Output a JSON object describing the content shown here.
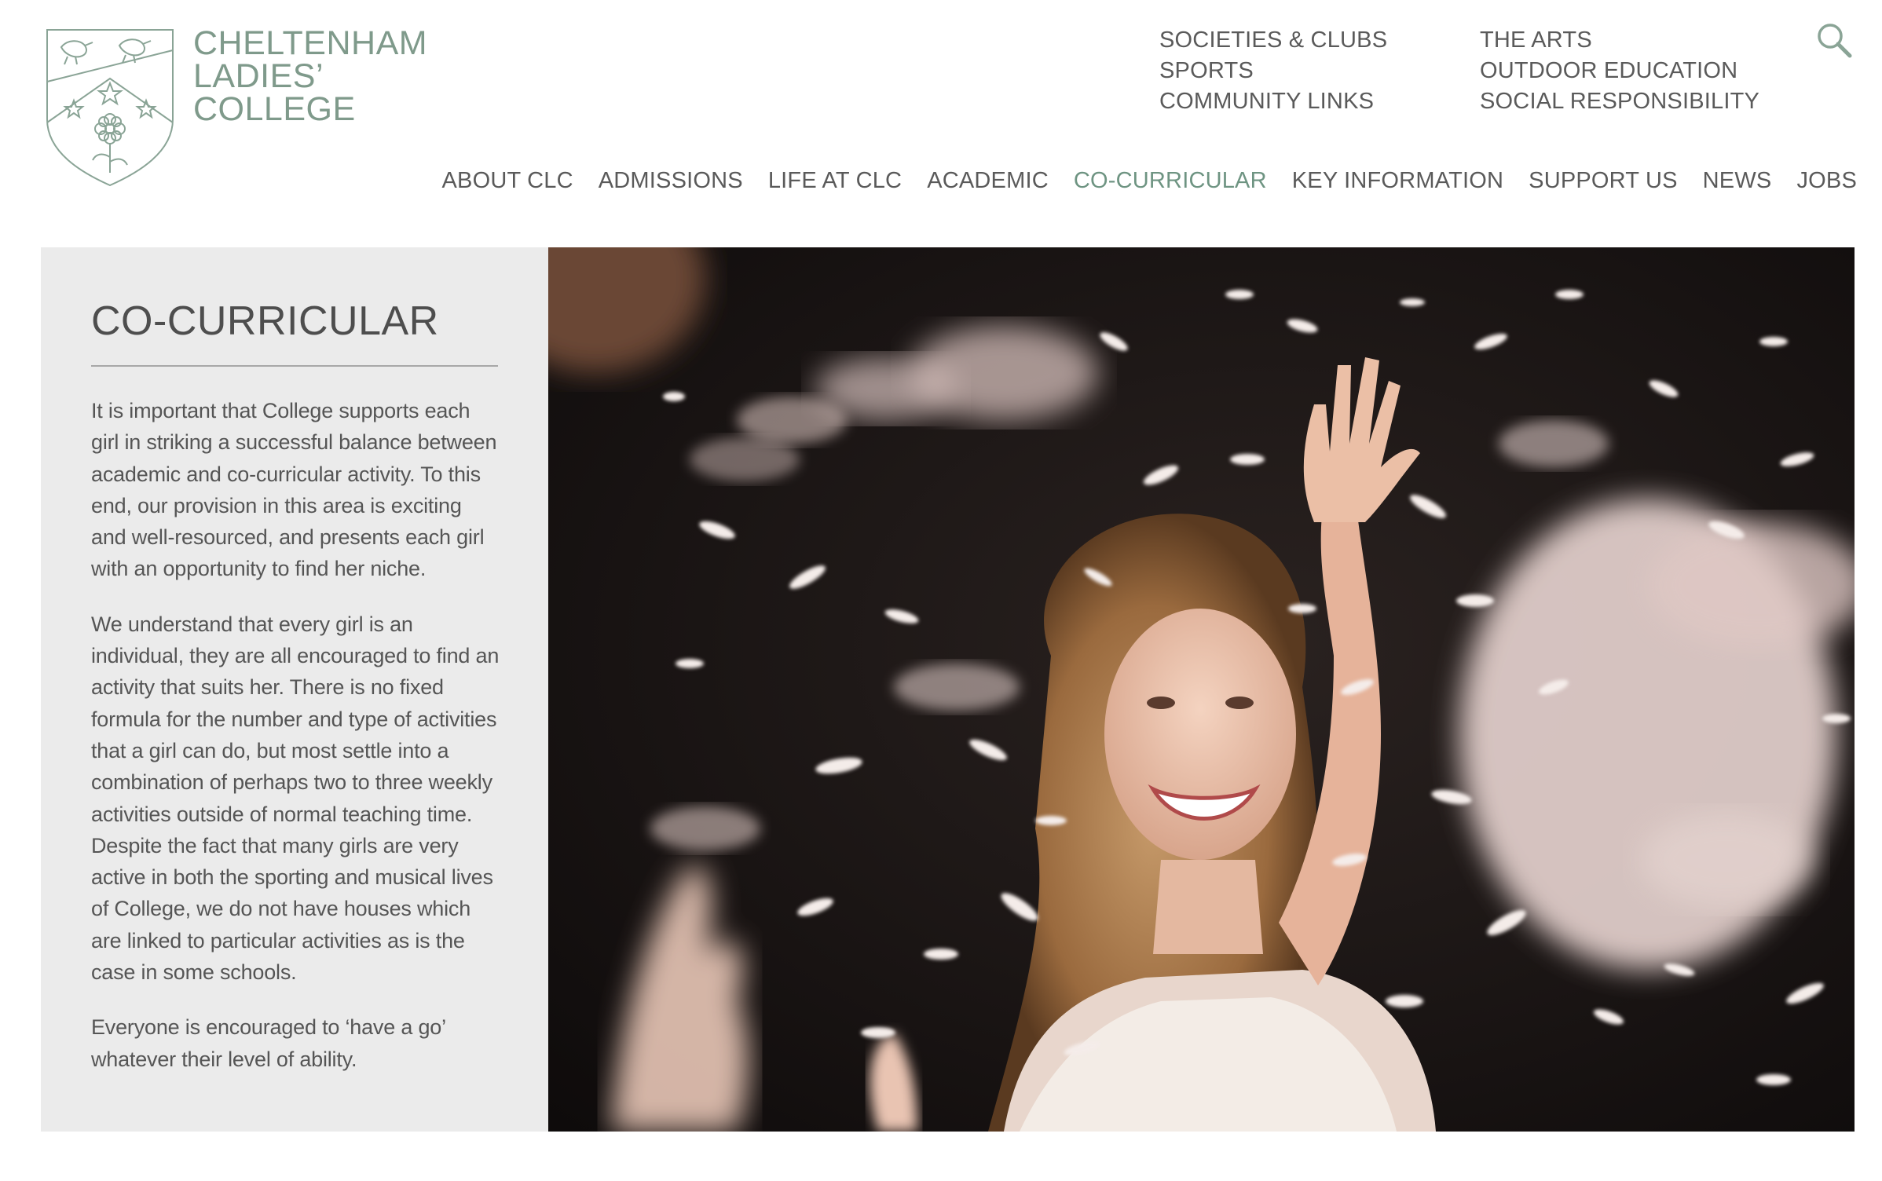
{
  "logo": {
    "line1": "CHELTENHAM",
    "line2": "LADIES’",
    "line3": "COLLEGE",
    "crest_icon": "school-crest-icon",
    "brand_color": "#7f9a8b"
  },
  "subnav": {
    "col1": [
      "SOCIETIES & CLUBS",
      "SPORTS",
      "COMMUNITY LINKS"
    ],
    "col2": [
      "THE ARTS",
      "OUTDOOR EDUCATION",
      "SOCIAL RESPONSIBILITY"
    ],
    "search_icon": "search-icon"
  },
  "mainnav": {
    "items": [
      "ABOUT CLC",
      "ADMISSIONS",
      "LIFE AT CLC",
      "ACADEMIC",
      "CO-CURRICULAR",
      "KEY INFORMATION",
      "SUPPORT US",
      "NEWS",
      "JOBS"
    ],
    "active": "CO-CURRICULAR",
    "active_color": "#6e9482"
  },
  "content": {
    "title": "CO-CURRICULAR",
    "paragraphs": [
      "It is important that College supports each girl in striking a successful balance between academic and co-curricular activity. To this end, our provision in this area is exciting and well-resourced, and presents each girl with an opportunity to find her niche.",
      "We understand that every girl is an individual, they are all encouraged to find an activity that suits her. There is no fixed formula for the number and type of activities that a girl can do, but most settle into a combination of perhaps two to three weekly activities outside of normal teaching time. Despite the fact that many girls are very active in both the sporting and musical lives of College, we do not have houses which are linked to particular activities as is the case in some schools.",
      "Everyone is encouraged to ‘have a go’ whatever their level of ability."
    ],
    "panel_color": "#ebebeb"
  },
  "hero": {
    "image_icon": "girl-with-feathers-photo"
  }
}
